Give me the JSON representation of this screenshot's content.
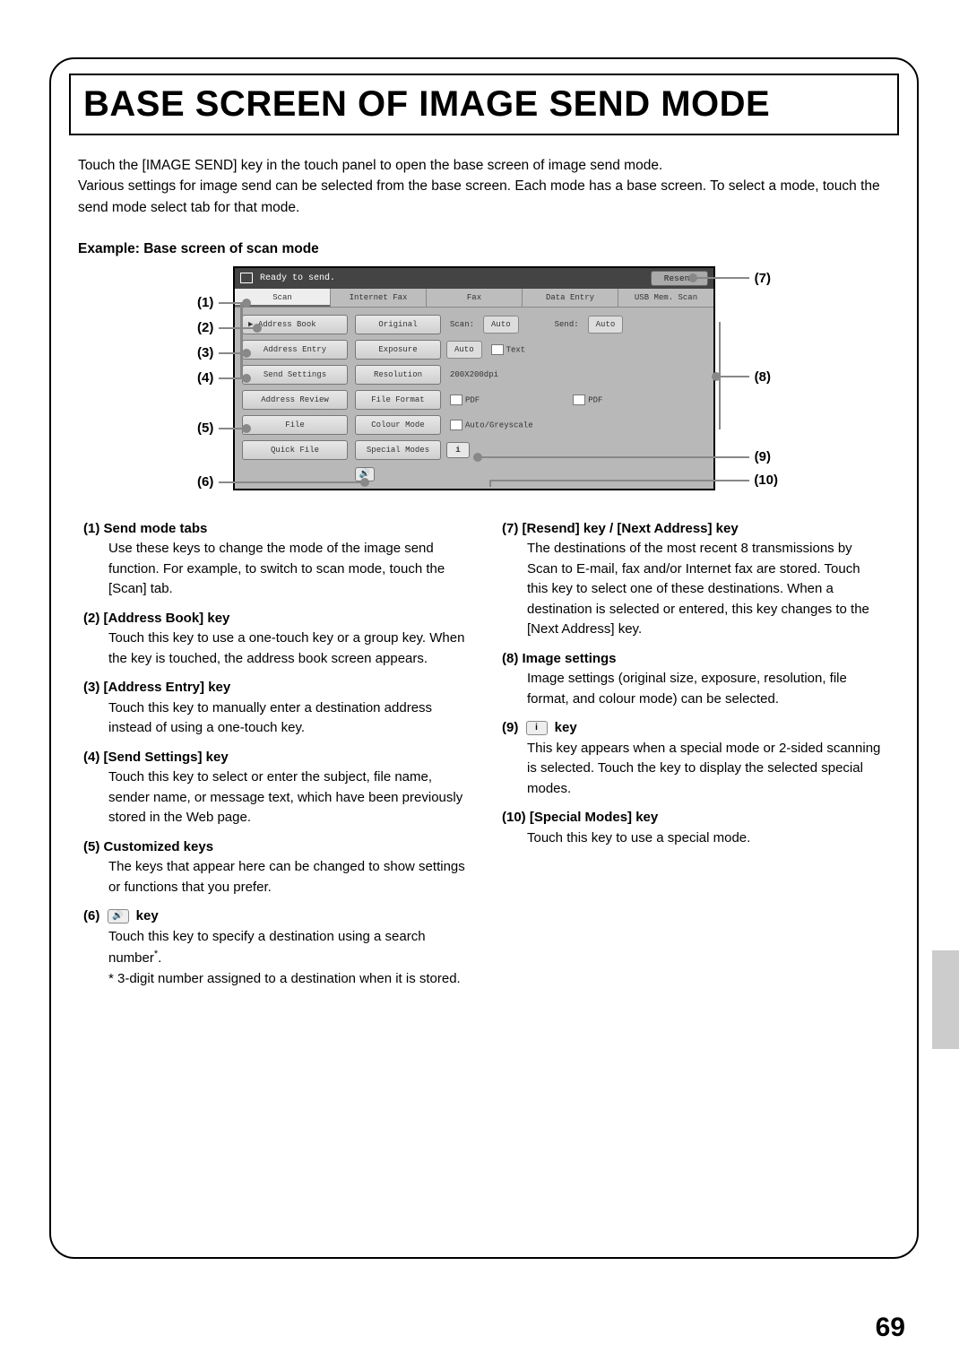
{
  "title": "BASE SCREEN OF IMAGE SEND MODE",
  "intro": "Touch the [IMAGE SEND] key in the touch panel to open the base screen of image send mode.\nVarious settings for image send can be selected from the base screen. Each mode has a base screen. To select a mode, touch the send mode select tab for that mode.",
  "example_label": "Example: Base screen of scan mode",
  "panel": {
    "ready": "Ready to send.",
    "resend": "Resend",
    "tabs": [
      "Scan",
      "Internet Fax",
      "Fax",
      "Data Entry",
      "USB Mem. Scan"
    ],
    "left_buttons": [
      "Address Book",
      "Address Entry",
      "Send Settings",
      "Address Review",
      "File",
      "Quick File"
    ],
    "rows": {
      "original": {
        "label": "Original",
        "scan_label": "Scan:",
        "scan_val": "Auto",
        "send_label": "Send:",
        "send_val": "Auto"
      },
      "exposure": {
        "label": "Exposure",
        "val": "Auto",
        "mode": "Text"
      },
      "resolution": {
        "label": "Resolution",
        "val": "200X200dpi"
      },
      "fileformat": {
        "label": "File Format",
        "val1": "PDF",
        "val2": "PDF"
      },
      "colour": {
        "label": "Colour Mode",
        "val": "Auto/Greyscale"
      },
      "special": {
        "label": "Special Modes"
      }
    }
  },
  "callouts": {
    "n1": "(1)",
    "n2": "(2)",
    "n3": "(3)",
    "n4": "(4)",
    "n5": "(5)",
    "n6": "(6)",
    "n7": "(7)",
    "n8": "(8)",
    "n9": "(9)",
    "n10": "(10)"
  },
  "items": {
    "i1": {
      "head": "(1) Send mode tabs",
      "body": "Use these keys to change the mode of the image send function. For example, to switch to scan mode, touch the [Scan] tab."
    },
    "i2": {
      "head": "(2) [Address Book] key",
      "body": "Touch this key to use a one-touch key or a group key. When the key is touched, the address book screen appears."
    },
    "i3": {
      "head": "(3) [Address Entry] key",
      "body": "Touch this key to manually enter a destination address instead of using a one-touch key."
    },
    "i4": {
      "head": "(4) [Send Settings] key",
      "body": "Touch this key to select or enter the subject, file name, sender name, or message text, which have been previously stored in the Web page."
    },
    "i5": {
      "head": "(5) Customized keys",
      "body": "The keys that appear here can be changed to show settings or functions that you prefer."
    },
    "i6": {
      "head_pre": "(6) ",
      "head_key": " key",
      "body": "Touch this key to specify a destination using a search number",
      "star": "*",
      "foot": "* 3-digit number assigned to a destination when it is stored."
    },
    "i7": {
      "head": "(7) [Resend] key / [Next Address] key",
      "body": "The destinations of the most recent 8 transmissions by Scan to E-mail, fax and/or Internet fax are stored. Touch this key to select one of these destinations. When a destination is selected or entered, this key changes to the [Next Address] key."
    },
    "i8": {
      "head": "(8) Image settings",
      "body": "Image settings (original size, exposure, resolution, file format, and colour mode) can be selected."
    },
    "i9": {
      "head_pre": "(9) ",
      "head_key": " key",
      "body": "This key appears when a special mode or 2-sided scanning is selected. Touch the key to display the selected special modes."
    },
    "i10": {
      "head": "(10) [Special Modes] key",
      "body": "Touch this key to use a special mode."
    }
  },
  "page_number": "69"
}
